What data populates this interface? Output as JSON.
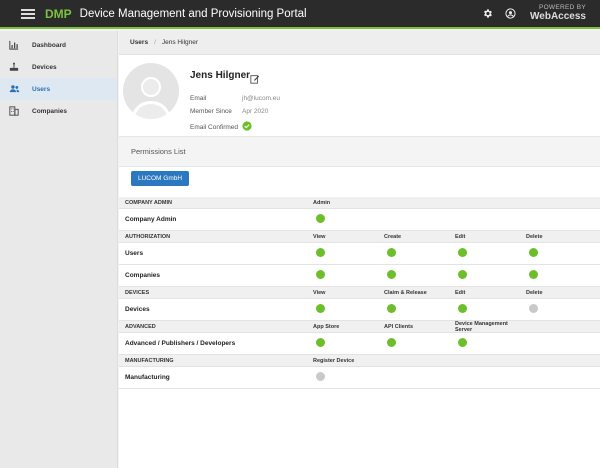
{
  "header": {
    "brand": "DMP",
    "title": "Device Management and Provisioning Portal",
    "powered_by": "POWERED BY",
    "powered_brand": "WebAccess"
  },
  "sidebar": {
    "items": [
      {
        "label": "Dashboard",
        "icon": "bar-chart-icon"
      },
      {
        "label": "Devices",
        "icon": "router-icon"
      },
      {
        "label": "Users",
        "icon": "users-icon",
        "active": true
      },
      {
        "label": "Companies",
        "icon": "building-icon"
      }
    ]
  },
  "breadcrumb": {
    "link": "Users",
    "separator": "/",
    "current": "Jens Hilgner"
  },
  "profile": {
    "name": "Jens Hilgner",
    "email_label": "Email",
    "email_value": "jh@lucom.eu",
    "since_label": "Member Since",
    "since_value": "Apr 2020",
    "confirmed_label": "Email Confirmed"
  },
  "permissions": {
    "title": "Permissions List",
    "company_button": "LUCOM GmbH",
    "sections": [
      {
        "name": "COMPANY ADMIN",
        "columns": [
          "Admin",
          "",
          "",
          ""
        ],
        "rows": [
          {
            "label": "Company Admin",
            "values": [
              "on",
              "",
              "",
              ""
            ]
          }
        ]
      },
      {
        "name": "AUTHORIZATION",
        "columns": [
          "View",
          "Create",
          "Edit",
          "Delete"
        ],
        "rows": [
          {
            "label": "Users",
            "values": [
              "on",
              "on",
              "on",
              "on"
            ]
          },
          {
            "label": "Companies",
            "values": [
              "on",
              "on",
              "on",
              "on"
            ]
          }
        ]
      },
      {
        "name": "DEVICES",
        "columns": [
          "View",
          "Claim & Release",
          "Edit",
          "Delete"
        ],
        "rows": [
          {
            "label": "Devices",
            "values": [
              "on",
              "on",
              "on",
              "off"
            ]
          }
        ]
      },
      {
        "name": "ADVANCED",
        "columns": [
          "App Store",
          "API Clients",
          "Device Management Server",
          ""
        ],
        "rows": [
          {
            "label": "Advanced / Publishers / Developers",
            "values": [
              "on",
              "on",
              "on",
              ""
            ]
          }
        ]
      },
      {
        "name": "MANUFACTURING",
        "columns": [
          "Register Device",
          "",
          "",
          ""
        ],
        "rows": [
          {
            "label": "Manufacturing",
            "values": [
              "off",
              "",
              "",
              ""
            ]
          }
        ]
      }
    ]
  },
  "colors": {
    "accent": "#7cc242",
    "primary": "#2b78c1",
    "topbar": "#2b2b2b",
    "on": "#6cbf2a",
    "off": "#c9c9c9"
  }
}
